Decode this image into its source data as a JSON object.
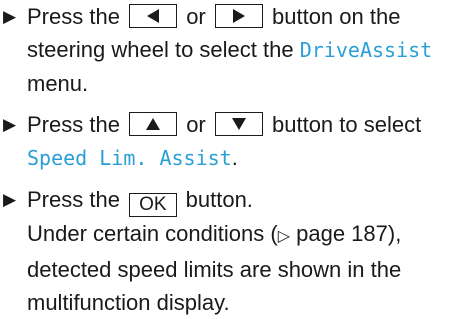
{
  "steps": [
    {
      "pre": "Press the",
      "mid": "or",
      "post": "button on the steering wheel to select the",
      "menu": "DriveAssist",
      "tail": "menu.",
      "key_left_icon": "triangle-left-icon",
      "key_right_icon": "triangle-right-icon"
    },
    {
      "pre": "Press the",
      "mid": "or",
      "post": "button to select",
      "menu": "Speed Lim. Assist",
      "tail": ".",
      "key_up_icon": "triangle-up-icon",
      "key_down_icon": "triangle-down-icon"
    },
    {
      "pre": "Press the",
      "key_label": "OK",
      "post": "button.",
      "note_pre": "Under certain conditions (",
      "page_ref": "page 187",
      "note_post": "), detected speed limits are shown in the multifunction display."
    }
  ],
  "bullet_icon": "right-triangle-bullet-icon",
  "page_ref_icon": "hollow-right-triangle-icon",
  "colors": {
    "text": "#1a1a1a",
    "menu_highlight": "#2a9fd6"
  }
}
